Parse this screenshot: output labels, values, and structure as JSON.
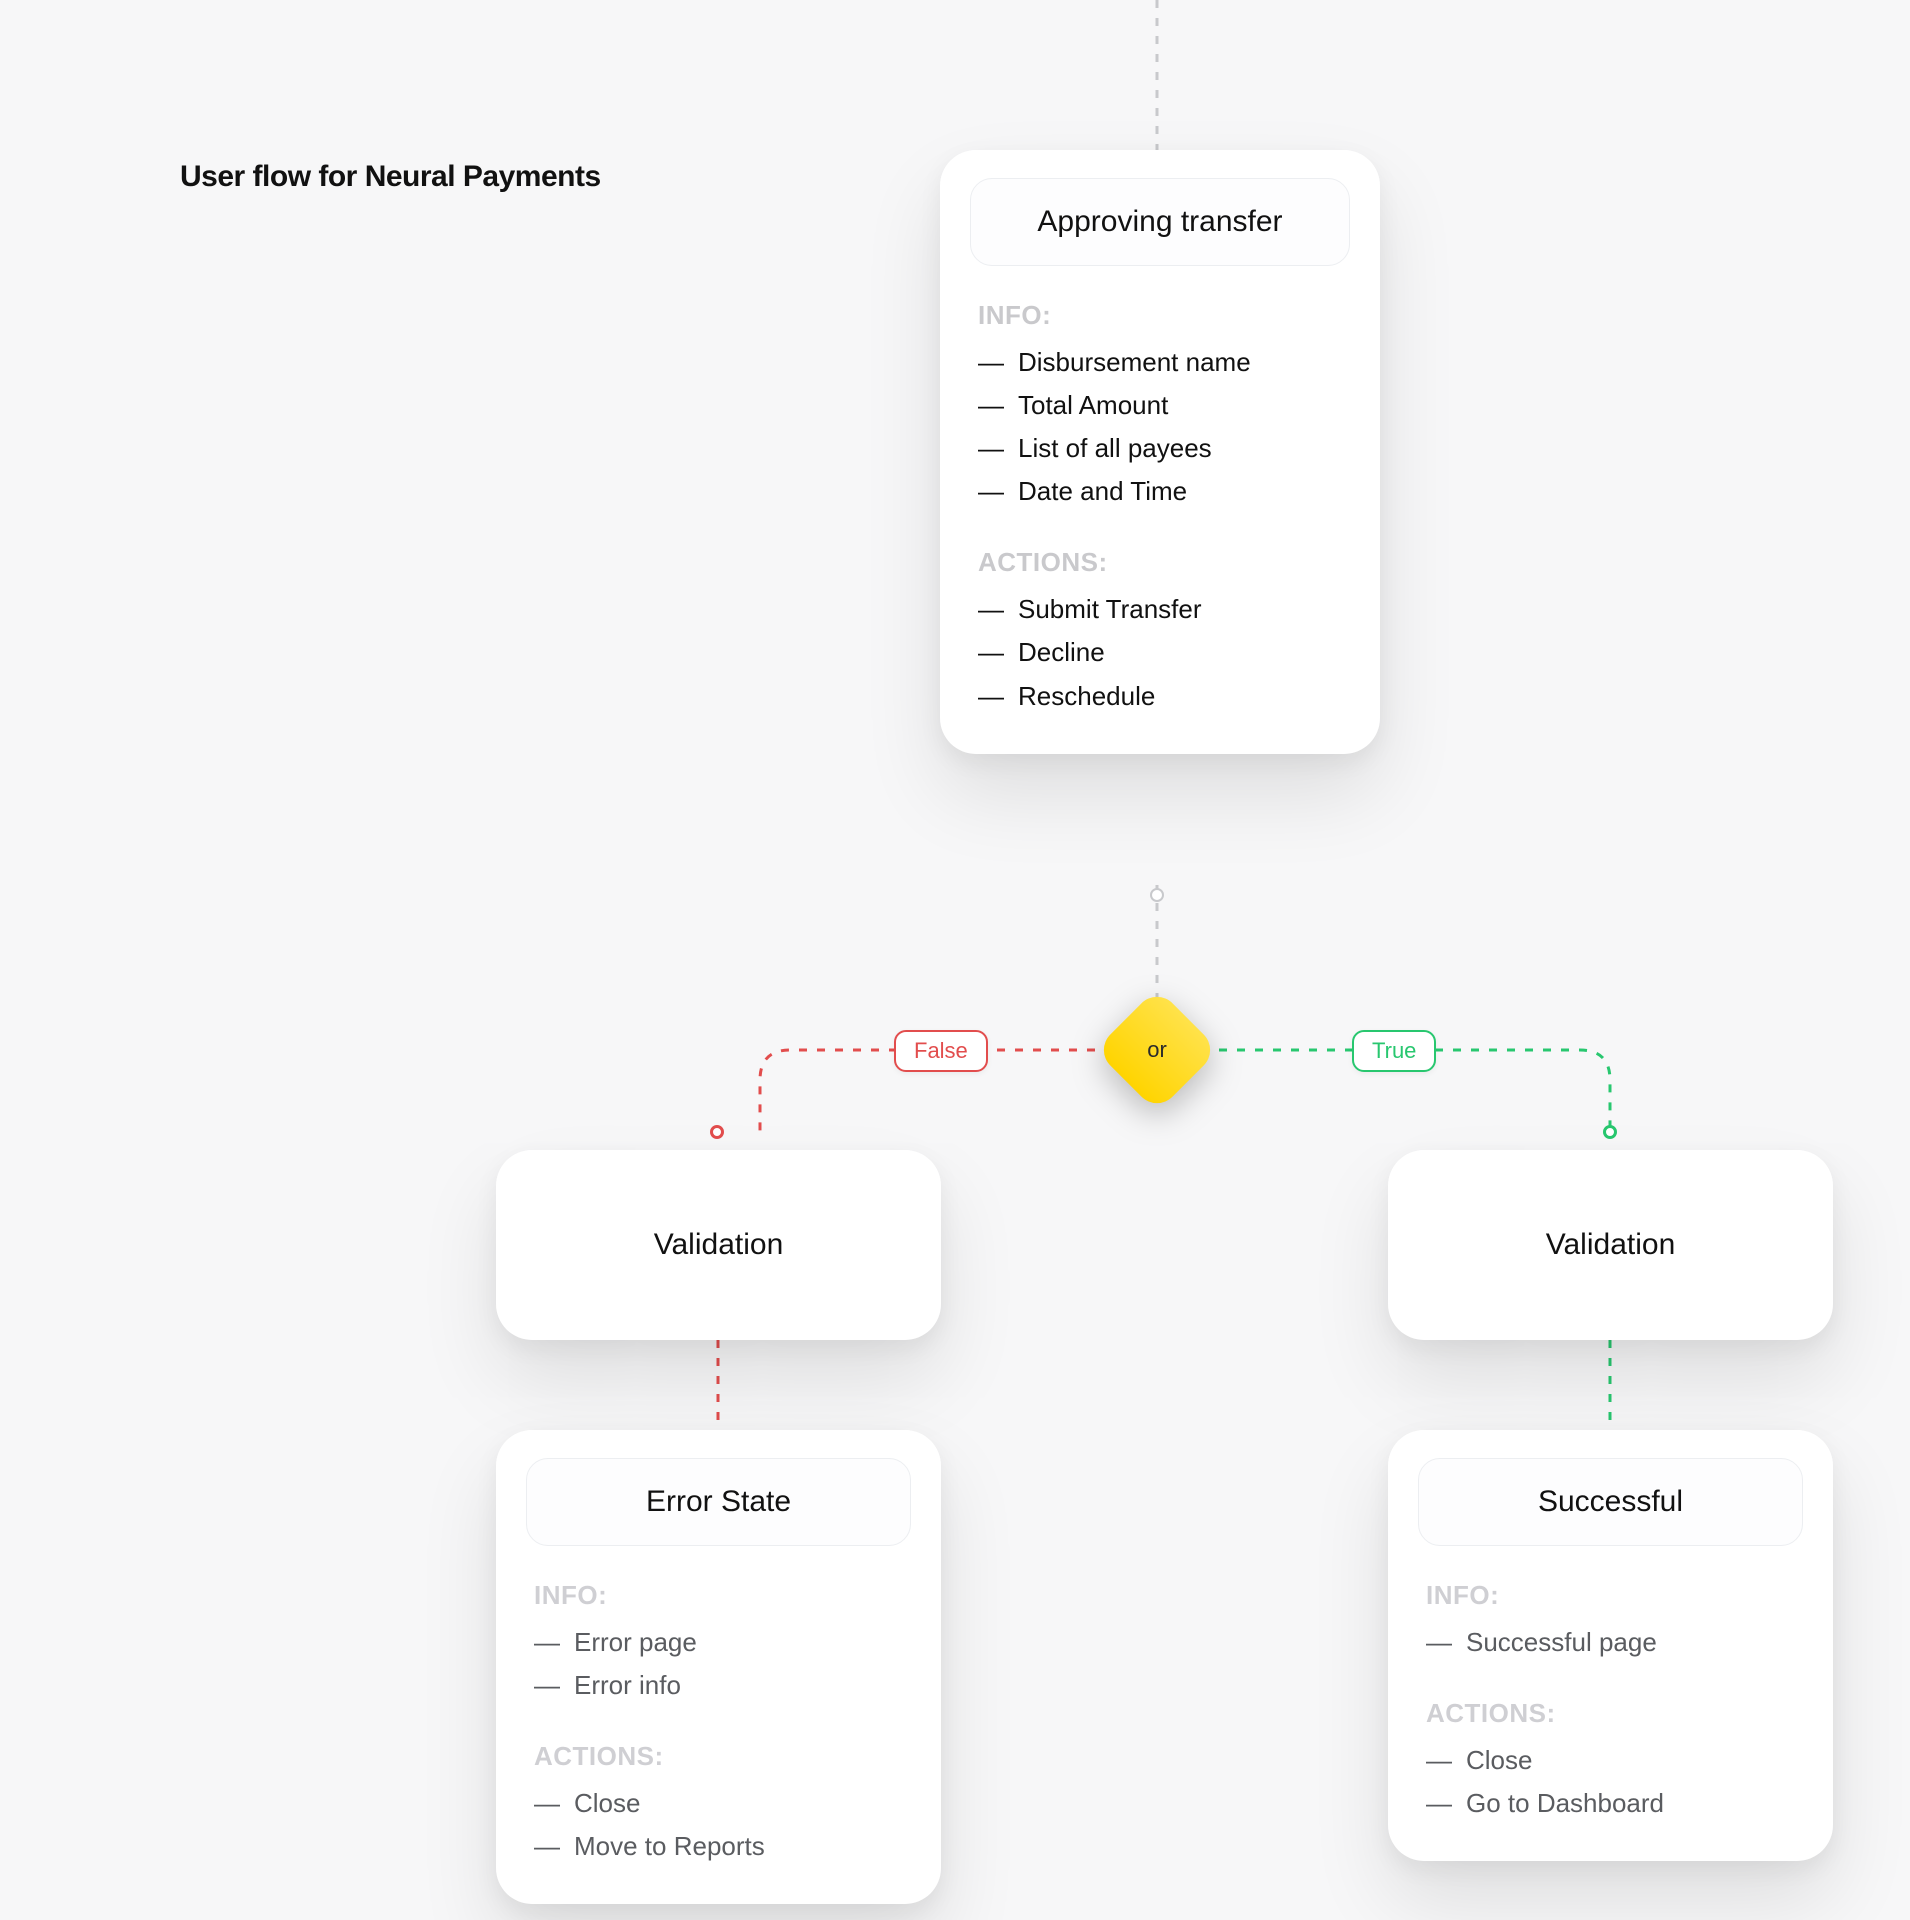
{
  "title": "User flow for Neural Payments",
  "decision": {
    "label": "or",
    "false_label": "False",
    "true_label": "True"
  },
  "nodes": {
    "approving": {
      "title": "Approving transfer",
      "info_label": "INFO:",
      "info": [
        "Disbursement name",
        "Total Amount",
        "List of all payees",
        "Date and Time"
      ],
      "actions_label": "ACTIONS:",
      "actions": [
        "Submit Transfer",
        "Decline",
        "Reschedule"
      ]
    },
    "validation_false": {
      "title": "Validation"
    },
    "validation_true": {
      "title": "Validation"
    },
    "error": {
      "title": "Error State",
      "info_label": "INFO:",
      "info": [
        "Error page",
        "Error info"
      ],
      "actions_label": "ACTIONS:",
      "actions": [
        "Close",
        "Move to Reports"
      ]
    },
    "success": {
      "title": "Successful",
      "info_label": "INFO:",
      "info": [
        "Successful page"
      ],
      "actions_label": "ACTIONS:",
      "actions": [
        "Close",
        "Go to Dashboard"
      ]
    }
  }
}
